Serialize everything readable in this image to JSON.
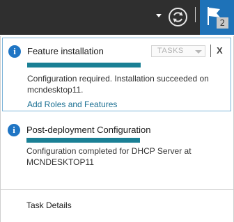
{
  "toolbar": {
    "dropdown_icon": "chevron-down-icon",
    "refresh_icon": "refresh-icon",
    "flag_icon": "flag-icon",
    "notification_count": "2",
    "colors": {
      "bar": "#2f2f2f",
      "flag_bg": "#1e72b8"
    }
  },
  "notifications": [
    {
      "icon": "info-icon",
      "title": "Feature installation",
      "tasks_label": "TASKS",
      "close_label": "X",
      "progress_fraction": 1.0,
      "message": "Configuration required. Installation succeeded on mcndesktop11.",
      "link": "Add Roles and Features"
    },
    {
      "icon": "info-icon",
      "title": "Post-deployment Configuration",
      "progress_fraction": 1.0,
      "message": "Configuration completed for DHCP Server at MCNDESKTOP11"
    }
  ],
  "footer": {
    "task_details": "Task Details"
  },
  "colors": {
    "progress": "#1a8095",
    "link": "#1a6f92",
    "info": "#1f75c4"
  }
}
